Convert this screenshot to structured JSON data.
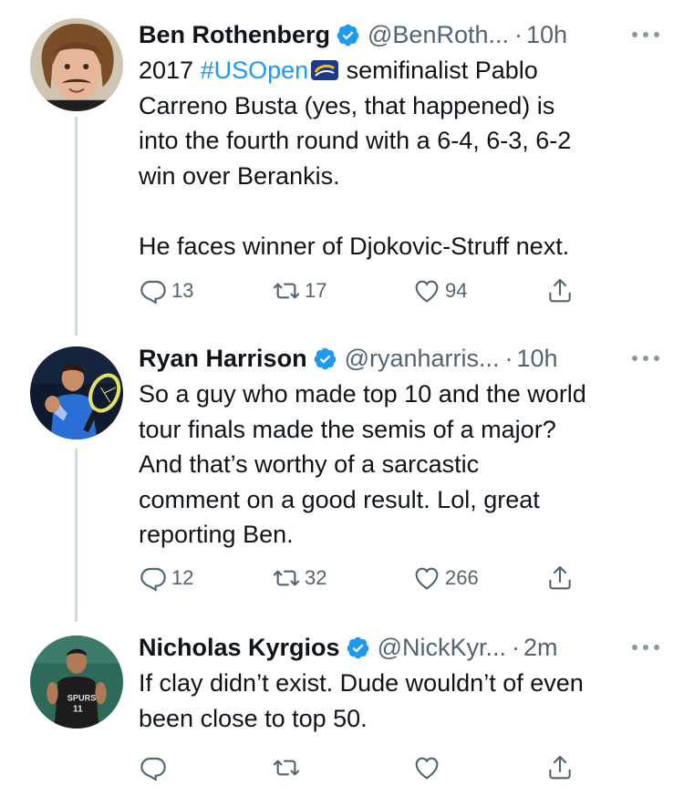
{
  "colors": {
    "accent": "#1d9bf0",
    "secondary_text": "#536471",
    "thread_line": "#cfd9de"
  },
  "tweets": [
    {
      "name": "Ben Rothenberg",
      "handle": "@BenRoth...",
      "separator": "·",
      "time": "10h",
      "verified": true,
      "text": {
        "line1_prefix": "2017 ",
        "hashtag": "#USOpen",
        "line1_suffix": " semifinalist Pablo",
        "line2": "Carreno Busta (yes, that happened) is",
        "line3": "into the fourth round with a 6-4, 6-3, 6-2",
        "line4": "win over Berankis.",
        "line5": "He faces winner of Djokovic-Struff next."
      },
      "replies": "13",
      "retweets": "17",
      "likes": "94"
    },
    {
      "name": "Ryan Harrison",
      "handle": "@ryanharris...",
      "separator": "·",
      "time": "10h",
      "verified": true,
      "text": {
        "line1": "So a guy who made top 10 and the world",
        "line2": "tour finals made the semis of a major?",
        "line3": "And that’s worthy of a sarcastic",
        "line4": "comment on a good result. Lol, great",
        "line5": "reporting Ben."
      },
      "replies": "12",
      "retweets": "32",
      "likes": "266"
    },
    {
      "name": "Nicholas Kyrgios",
      "handle": "@NickKyr...",
      "separator": "·",
      "time": "2m",
      "verified": true,
      "text": {
        "line1": "If clay didn’t exist. Dude wouldn’t of even",
        "line2": "been close to top 50."
      },
      "replies": "",
      "retweets": "",
      "likes": ""
    }
  ]
}
